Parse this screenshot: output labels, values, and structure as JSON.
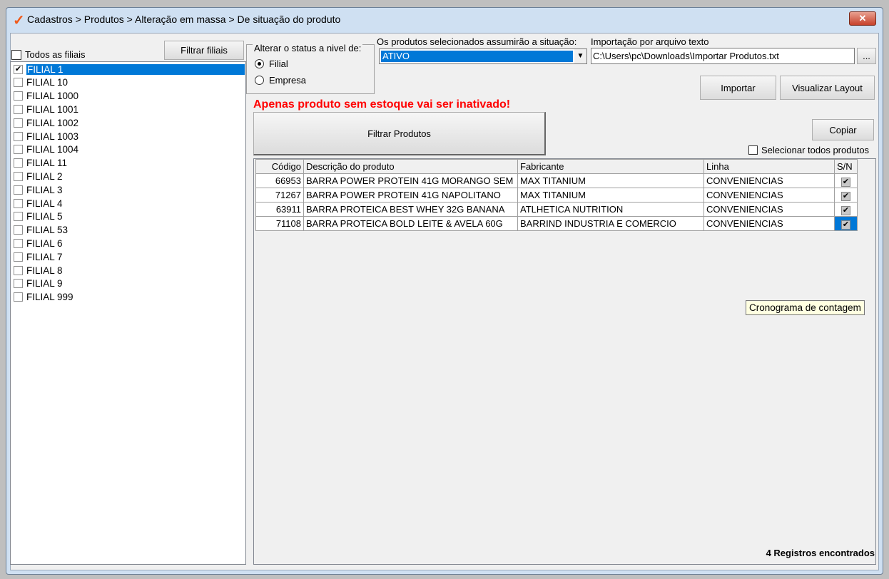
{
  "window": {
    "title": "Cadastros > Produtos > Alteração em massa > De situação do produto",
    "close": "✕"
  },
  "branches": {
    "all_label": "Todos as filiais",
    "filter_button": "Filtrar filiais",
    "items": [
      {
        "label": "FILIAL 1",
        "checked": true
      },
      {
        "label": "FILIAL 10"
      },
      {
        "label": "FILIAL 1000"
      },
      {
        "label": "FILIAL 1001"
      },
      {
        "label": "FILIAL 1002"
      },
      {
        "label": "FILIAL 1003"
      },
      {
        "label": "FILIAL 1004"
      },
      {
        "label": "FILIAL 11"
      },
      {
        "label": "FILIAL 2"
      },
      {
        "label": "FILIAL 3"
      },
      {
        "label": "FILIAL 4"
      },
      {
        "label": "FILIAL 5"
      },
      {
        "label": "FILIAL 53"
      },
      {
        "label": "FILIAL 6"
      },
      {
        "label": "FILIAL 7"
      },
      {
        "label": "FILIAL 8"
      },
      {
        "label": "FILIAL 9"
      },
      {
        "label": "FILIAL 999"
      }
    ]
  },
  "level": {
    "legend": "Alterar o status a nivel de:",
    "options": [
      "Filial",
      "Empresa"
    ],
    "selected": "Filial"
  },
  "status": {
    "label": "Os produtos selecionados assumirão a situação:",
    "value": "ATIVO"
  },
  "import": {
    "label": "Importação por arquivo texto",
    "path": "C:\\Users\\pc\\Downloads\\Importar Produtos.txt",
    "browse": "...",
    "import_button": "Importar",
    "layout_button": "Visualizar Layout"
  },
  "warning": "Apenas produto sem estoque vai ser inativado!",
  "filter_products": "Filtrar Produtos",
  "copy": "Copiar",
  "select_all": "Selecionar todos produtos",
  "table": {
    "headers": [
      "Código",
      "Descrição do produto",
      "Fabricante",
      "Linha",
      "S/N"
    ],
    "rows": [
      [
        "66953",
        "BARRA POWER PROTEIN 41G MORANGO SEM",
        "MAX TITANIUM",
        "CONVENIENCIAS",
        "✔"
      ],
      [
        "71267",
        "BARRA POWER PROTEIN 41G NAPOLITANO",
        "MAX TITANIUM",
        "CONVENIENCIAS",
        "✔"
      ],
      [
        "63911",
        "BARRA PROTEICA BEST WHEY 32G BANANA",
        "ATLHETICA NUTRITION",
        "CONVENIENCIAS",
        "✔"
      ],
      [
        "71108",
        "BARRA PROTEICA BOLD LEITE & AVELA 60G",
        "BARRIND INDUSTRIA E COMERCIO",
        "CONVENIENCIAS",
        "✔"
      ]
    ]
  },
  "tooltip": "Cronograma de contagem",
  "footer": "4 Registros encontrados"
}
